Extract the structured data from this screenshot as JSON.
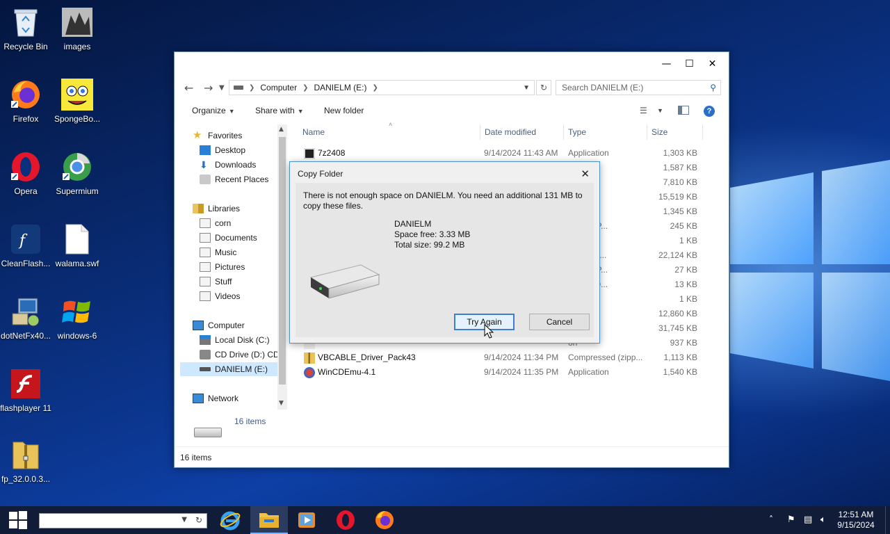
{
  "desktop": {
    "icons": [
      {
        "label": "Recycle Bin"
      },
      {
        "label": "images"
      },
      {
        "label": "Firefox"
      },
      {
        "label": "SpongeBo..."
      },
      {
        "label": "Opera"
      },
      {
        "label": "Supermium"
      },
      {
        "label": "CleanFlash..."
      },
      {
        "label": "walama.swf"
      },
      {
        "label": "dotNetFx40..."
      },
      {
        "label": "windows-6"
      },
      {
        "label": "flashplayer 11"
      },
      {
        "label": "fp_32.0.0.3..."
      }
    ]
  },
  "explorer": {
    "address": {
      "crumbs": [
        "Computer",
        "DANIELM (E:)"
      ]
    },
    "search_placeholder": "Search DANIELM (E:)",
    "toolbar": {
      "organize": "Organize",
      "share_with": "Share with",
      "new_folder": "New folder"
    },
    "nav": {
      "favorites": "Favorites",
      "desktop": "Desktop",
      "downloads": "Downloads",
      "recent_places": "Recent Places",
      "libraries": "Libraries",
      "corn": "corn",
      "documents": "Documents",
      "music": "Music",
      "pictures": "Pictures",
      "stuff": "Stuff",
      "videos": "Videos",
      "computer": "Computer",
      "local_disk": "Local Disk (C:)",
      "cd_drive": "CD Drive (D:) CDI",
      "danielm": "DANIELM (E:)",
      "network": "Network"
    },
    "columns": {
      "name": "Name",
      "date": "Date modified",
      "type": "Type",
      "size": "Size"
    },
    "files": [
      {
        "name": "7z2408",
        "date": "9/14/2024 11:43 AM",
        "type": "Application",
        "size": "1,303 KB"
      },
      {
        "name": "",
        "date": "",
        "type": "on",
        "size": "1,587 KB"
      },
      {
        "name": "",
        "date": "",
        "type": "on",
        "size": "7,810 KB"
      },
      {
        "name": "",
        "date": "",
        "type": "on",
        "size": "15,519 KB"
      },
      {
        "name": "",
        "date": "",
        "type": "on",
        "size": "1,345 KB"
      },
      {
        "name": "",
        "date": "",
        "type": "t PowerP...",
        "size": "245 KB"
      },
      {
        "name": "",
        "date": "",
        "type": "ument",
        "size": "1 KB"
      },
      {
        "name": "",
        "date": "",
        "type": "Installer ...",
        "size": "22,124 KB"
      },
      {
        "name": "",
        "date": "",
        "type": "t PowerP...",
        "size": "27 KB"
      },
      {
        "name": "",
        "date": "",
        "type": "t Word D...",
        "size": "13 KB"
      },
      {
        "name": "",
        "date": "",
        "type": "und",
        "size": "1 KB"
      },
      {
        "name": "",
        "date": "",
        "type": "on",
        "size": "12,860 KB"
      },
      {
        "name": "",
        "date": "",
        "type": "on",
        "size": "31,745 KB"
      },
      {
        "name": "",
        "date": "",
        "type": "on",
        "size": "937 KB"
      },
      {
        "name": "VBCABLE_Driver_Pack43",
        "date": "9/14/2024 11:34 PM",
        "type": "Compressed (zipp...",
        "size": "1,113 KB"
      },
      {
        "name": "WinCDEmu-4.1",
        "date": "9/14/2024 11:35 PM",
        "type": "Application",
        "size": "1,540 KB"
      }
    ],
    "details_count": "16 items",
    "status": "16 items"
  },
  "dialog": {
    "title": "Copy Folder",
    "message": "There is not enough space on DANIELM. You need an additional 131 MB to copy these files.",
    "drive_name": "DANIELM",
    "space_free": "Space free: 3.33 MB",
    "total_size": "Total size: 99.2 MB",
    "try_again": "Try Again",
    "cancel": "Cancel"
  },
  "taskbar": {
    "time": "12:51 AM",
    "date": "9/15/2024"
  }
}
